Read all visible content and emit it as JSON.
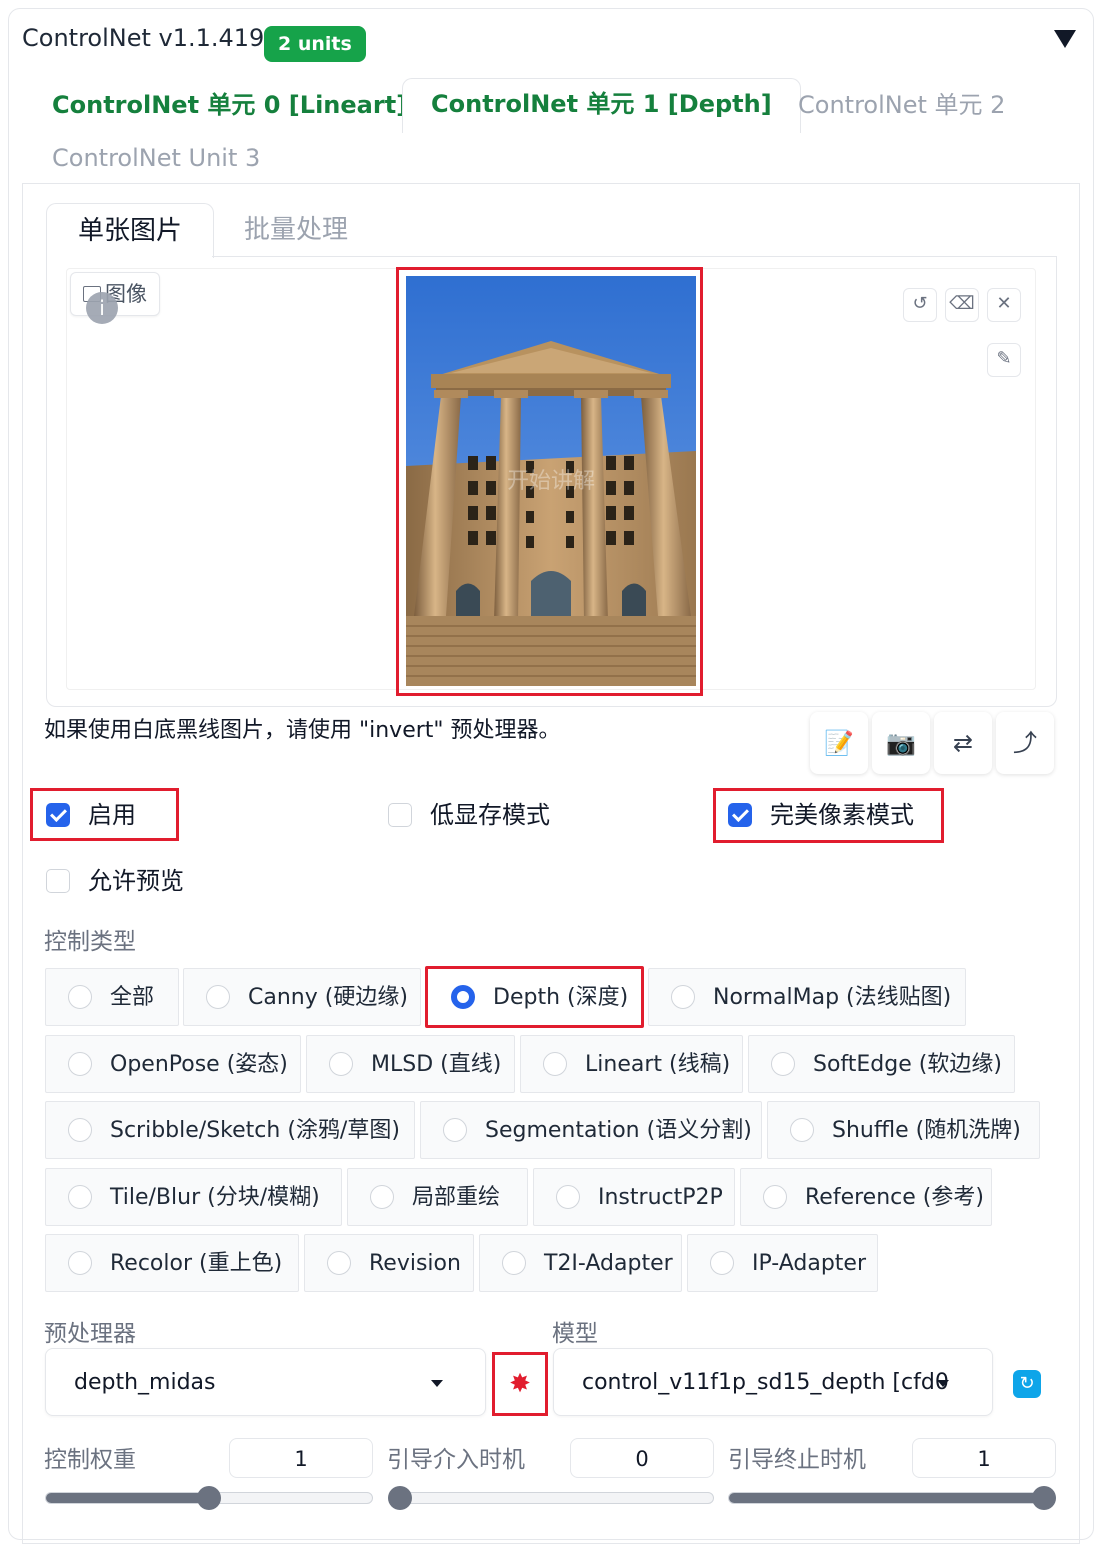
{
  "header": {
    "title": "ControlNet v1.1.419",
    "badge": "2 units"
  },
  "unit_tabs": [
    {
      "label": "ControlNet 单元 0 [Lineart]"
    },
    {
      "label": "ControlNet 单元 1 [Depth]"
    },
    {
      "label": "ControlNet 单元 2"
    },
    {
      "label": "ControlNet Unit 3"
    }
  ],
  "sub_tabs": [
    {
      "label": "单张图片"
    },
    {
      "label": "批量处理"
    }
  ],
  "image_panel": {
    "label": "图像",
    "watermark": "开始讲解"
  },
  "hint": "如果使用白底黑线图片，请使用 \"invert\" 预处理器。",
  "checkboxes": {
    "enable": {
      "label": "启用",
      "checked": true
    },
    "low_vram": {
      "label": "低显存模式",
      "checked": false
    },
    "pixel_perfect": {
      "label": "完美像素模式",
      "checked": true
    },
    "allow_preview": {
      "label": "允许预览",
      "checked": false
    }
  },
  "control_type": {
    "label": "控制类型",
    "selected": "Depth (深度)",
    "options": [
      "全部",
      "Canny (硬边缘)",
      "Depth (深度)",
      "NormalMap (法线贴图)",
      "OpenPose (姿态)",
      "MLSD (直线)",
      "Lineart (线稿)",
      "SoftEdge (软边缘)",
      "Scribble/Sketch (涂鸦/草图)",
      "Segmentation (语义分割)",
      "Shuffle (随机洗牌)",
      "Tile/Blur (分块/模糊)",
      "局部重绘",
      "InstructP2P",
      "Reference (参考)",
      "Recolor (重上色)",
      "Revision",
      "T2I-Adapter",
      "IP-Adapter"
    ]
  },
  "preprocessor": {
    "label": "预处理器",
    "value": "depth_midas"
  },
  "model": {
    "label": "模型",
    "value": "control_v11f1p_sd15_depth [cfd0"
  },
  "sliders": {
    "weight": {
      "label": "控制权重",
      "value": "1",
      "fraction": 0.5
    },
    "start": {
      "label": "引导介入时机",
      "value": "0",
      "fraction": 0.0
    },
    "end": {
      "label": "引导终止时机",
      "value": "1",
      "fraction": 1.0
    }
  },
  "colors": {
    "accent_green": "#16a34a",
    "selection_blue": "#2563eb",
    "highlight_red": "#e11d2e"
  }
}
